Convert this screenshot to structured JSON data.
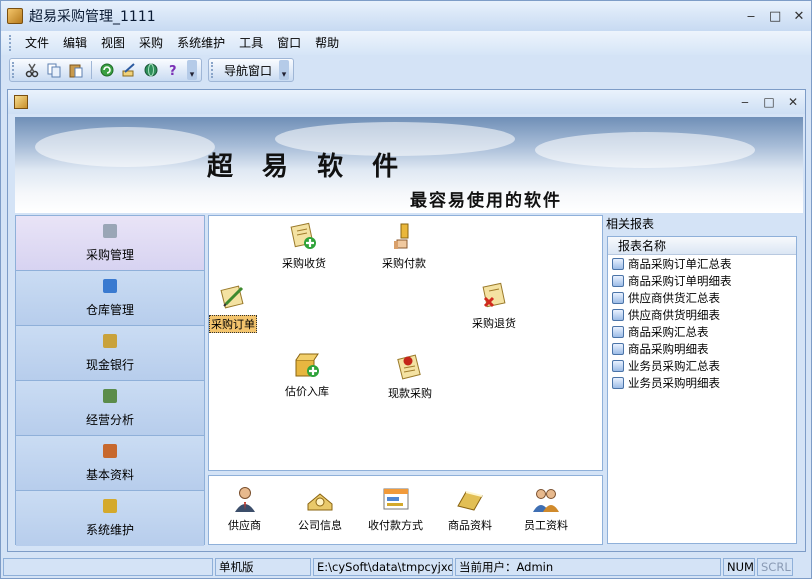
{
  "window": {
    "title": "超易采购管理_1111"
  },
  "menu": [
    "文件",
    "编辑",
    "视图",
    "采购",
    "系统维护",
    "工具",
    "窗口",
    "帮助"
  ],
  "toolbar": {
    "nav_window": "导航窗口"
  },
  "banner": {
    "brand": "超 易 软 件",
    "slogan": "最容易使用的软件"
  },
  "sidebar": {
    "items": [
      {
        "label": "采购管理",
        "active": true,
        "color": "#9aa6b6"
      },
      {
        "label": "仓库管理",
        "active": false,
        "color": "#3a7ad0"
      },
      {
        "label": "现金银行",
        "active": false,
        "color": "#c9a23b"
      },
      {
        "label": "经营分析",
        "active": false,
        "color": "#5b8c4a"
      },
      {
        "label": "基本资料",
        "active": false,
        "color": "#c7682d"
      },
      {
        "label": "系统维护",
        "active": false,
        "color": "#d4a92c"
      }
    ]
  },
  "workflow": {
    "receive": "采购收货",
    "payment": "采购付款",
    "order": "采购订单",
    "return": "采购退货",
    "estimate": "估价入库",
    "cash": "现款采购"
  },
  "basics": [
    "供应商",
    "公司信息",
    "收付款方式",
    "商品资料",
    "员工资料"
  ],
  "reports": {
    "title": "相关报表",
    "header": "报表名称",
    "items": [
      "商品采购订单汇总表",
      "商品采购订单明细表",
      "供应商供货汇总表",
      "供应商供货明细表",
      "商品采购汇总表",
      "商品采购明细表",
      "业务员采购汇总表",
      "业务员采购明细表"
    ]
  },
  "status": {
    "edition": "单机版",
    "path": "E:\\cySoft\\data\\tmpcyjxc.sys",
    "user": "当前用户：Admin",
    "num": "NUM",
    "scrl": "SCRL"
  }
}
